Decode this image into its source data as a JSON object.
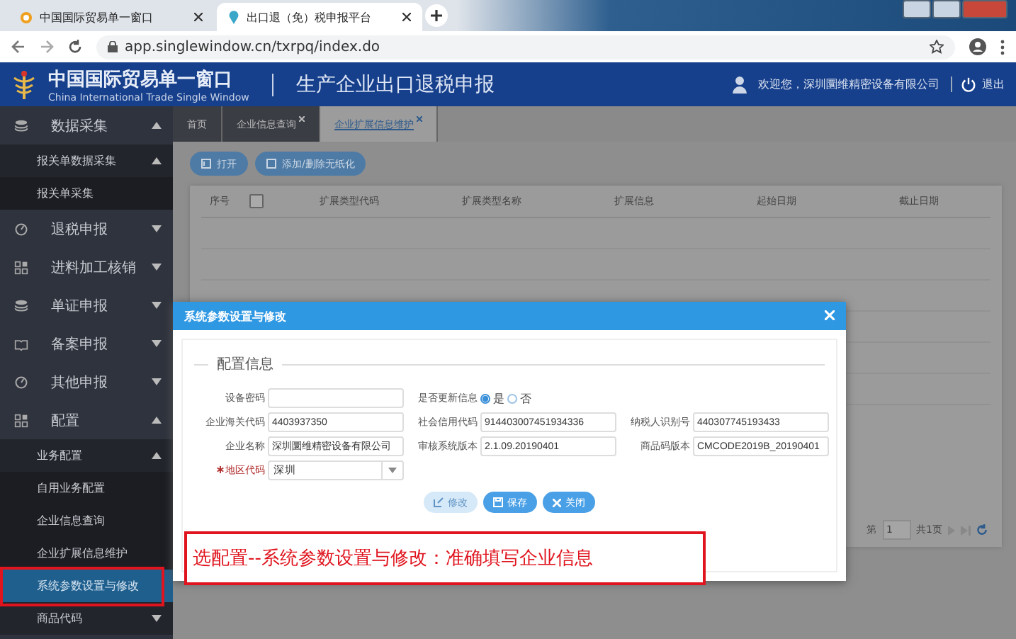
{
  "browser": {
    "tabs": [
      {
        "title": "中国国际贸易单一窗口",
        "selected": false
      },
      {
        "title": "出口退（免）税申报平台",
        "selected": true
      }
    ],
    "url": "app.singlewindow.cn/txrpq/index.do"
  },
  "header": {
    "logo_cn": "中国国际贸易单一窗口",
    "logo_en": "China International Trade Single Window",
    "title": "生产企业出口退税申报",
    "welcome": "欢迎您，深圳圜维精密设备有限公司",
    "logout": "退出"
  },
  "sidebar": {
    "items": [
      {
        "label": "数据采集",
        "expanded": true,
        "children": [
          {
            "label": "报关单数据采集",
            "expanded": true,
            "children": [
              {
                "label": "报关单采集",
                "selected": false
              }
            ]
          }
        ]
      },
      {
        "label": "退税申报",
        "expanded": false
      },
      {
        "label": "进料加工核销",
        "expanded": false
      },
      {
        "label": "单证申报",
        "expanded": false
      },
      {
        "label": "备案申报",
        "expanded": false
      },
      {
        "label": "其他申报",
        "expanded": false
      },
      {
        "label": "配置",
        "expanded": true,
        "children": [
          {
            "label": "业务配置",
            "expanded": true,
            "children": [
              {
                "label": "自用业务配置",
                "selected": false
              },
              {
                "label": "企业信息查询",
                "selected": false
              },
              {
                "label": "企业扩展信息维护",
                "selected": false
              },
              {
                "label": "系统参数设置与修改",
                "selected": true
              }
            ]
          },
          {
            "label": "商品代码",
            "expanded": false
          }
        ]
      }
    ]
  },
  "content": {
    "tabs": [
      {
        "label": "首页",
        "closable": false,
        "selected": false
      },
      {
        "label": "企业信息查询",
        "closable": true,
        "selected": false
      },
      {
        "label": "企业扩展信息维护",
        "closable": true,
        "selected": true
      }
    ],
    "toolbar": [
      {
        "label": "打开"
      },
      {
        "label": "添加/删除无纸化"
      }
    ],
    "table": {
      "select_all": {
        "checked": false
      },
      "columns": [
        "序号",
        "扩展类型代码",
        "扩展类型名称",
        "扩展信息",
        "起始日期",
        "截止日期"
      ]
    },
    "pagination": {
      "page_label": "第",
      "page": "1",
      "total": "共1页"
    }
  },
  "dialog": {
    "title": "系统参数设置与修改",
    "section": "配置信息",
    "fields": [
      {
        "kind": "text",
        "label": "设备密码",
        "required": false
      },
      {
        "kind": "radio",
        "label": "是否更新信息",
        "options": [
          {
            "label": "是",
            "selected": true
          },
          {
            "label": "否",
            "selected": false
          }
        ]
      },
      {
        "kind": "spacer"
      },
      {
        "kind": "text",
        "label": "企业海关代码",
        "value": "4403937350",
        "required": false
      },
      {
        "kind": "text",
        "label": "社会信用代码",
        "value": "914403007451934336",
        "required": false
      },
      {
        "kind": "text",
        "label": "纳税人识别号",
        "value": "440307745193433",
        "required": false
      },
      {
        "kind": "text",
        "label": "企业名称",
        "value": "深圳圜维精密设备有限公司",
        "required": false
      },
      {
        "kind": "text",
        "label": "审核系统版本",
        "value": "2.1.09.20190401",
        "required": false
      },
      {
        "kind": "text",
        "label": "商品码版本",
        "value": "CMCODE2019B_20190401",
        "required": false
      },
      {
        "kind": "select",
        "label": "地区代码",
        "value": "深圳",
        "required": true
      }
    ],
    "buttons": [
      {
        "label": "修改",
        "disabled": true
      },
      {
        "label": "保存",
        "disabled": false
      },
      {
        "label": "关闭",
        "disabled": false
      }
    ]
  },
  "annotation": "选配置--系统参数设置与修改：准确填写企业信息"
}
